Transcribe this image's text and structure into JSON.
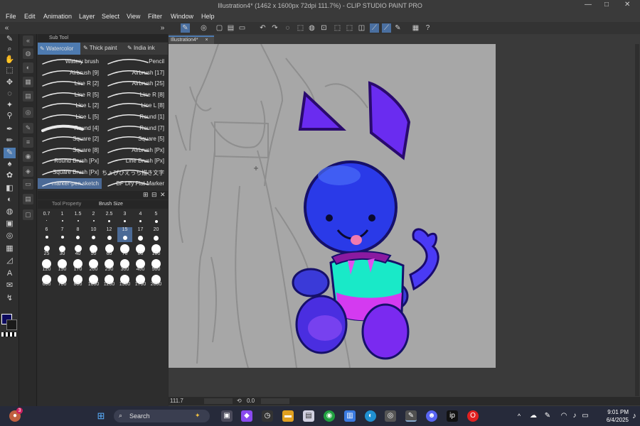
{
  "window": {
    "title": "Illustration4* (1462 x 1600px 72dpi 111.7%) - CLIP STUDIO PAINT PRO",
    "minimize": "—",
    "maximize": "□",
    "close": "✕"
  },
  "menu": [
    "File",
    "Edit",
    "Animation",
    "Layer",
    "Select",
    "View",
    "Filter",
    "Window",
    "Help"
  ],
  "subtool": {
    "header": "Sub Tool",
    "tabs": [
      "Watercolor",
      "Thick paint",
      "India ink"
    ],
    "brushes_left": [
      "Watery brush",
      "Airbrush [9]",
      "Line R [2]",
      "Line R [5]",
      "Line L [2]",
      "Line L [5]",
      "Round [4]",
      "Square [2]",
      "Square [8]",
      "Round Brush [Px]",
      "Square Brush [Px]",
      "marker-pen sketch"
    ],
    "brushes_right": [
      "Pencil",
      "Airbrush [17]",
      "Airbrush [25]",
      "Line R [8]",
      "Line L [8]",
      "Round [1]",
      "Round [7]",
      "Square [5]",
      "Airbrush [Px]",
      "Line Brush [Px]",
      "ちょびひえっち描き文字",
      "BF Dry Flat Marker"
    ]
  },
  "brushsize": {
    "tab_property": "Tool Property",
    "tab_size": "Brush Size",
    "sizes": [
      "0.7",
      "1",
      "1.5",
      "2",
      "2.5",
      "3",
      "4",
      "5",
      "6",
      "7",
      "8",
      "10",
      "12",
      "15",
      "17",
      "20",
      "25",
      "30",
      "40",
      "50",
      "60",
      "70",
      "80",
      "100",
      "120",
      "150",
      "170",
      "200",
      "250",
      "300",
      "400",
      "500",
      "600",
      "700",
      "800",
      "1000",
      "1200",
      "1500",
      "1700",
      "2000"
    ],
    "selected": "15"
  },
  "document": {
    "tab": "Illustration4*",
    "close": "×"
  },
  "status": {
    "zoom": "111.7",
    "rotation": "0.0"
  },
  "taskbar": {
    "search_placeholder": "Search",
    "time": "9:01 PM",
    "date": "6/4/2025",
    "badge": "3"
  },
  "colors": {
    "main": "#0d0a5e",
    "accent": "#4e7bb0",
    "paper": "#a7a7a7"
  },
  "icons": [
    "start-icon",
    "search-icon",
    "task-view-icon",
    "copilot-icon",
    "file-explorer-icon",
    "chrome-icon",
    "discord-icon",
    "opera-icon",
    "wifi-icon",
    "speaker-icon",
    "battery-icon"
  ]
}
